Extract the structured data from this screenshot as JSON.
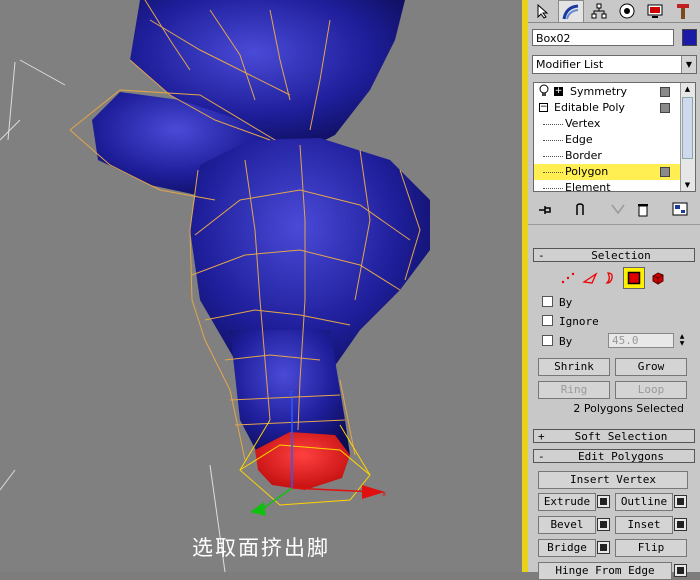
{
  "caption": "选取面挤出脚",
  "panel": {
    "tabs": [
      {
        "name": "create-tab",
        "icon": "pointer-icon"
      },
      {
        "name": "modify-tab",
        "icon": "curve-icon"
      },
      {
        "name": "hierarchy-tab",
        "icon": "hierarchy-icon"
      },
      {
        "name": "motion-tab",
        "icon": "motion-icon"
      },
      {
        "name": "display-tab",
        "icon": "monitor-icon"
      },
      {
        "name": "utilities-tab",
        "icon": "hammer-icon"
      }
    ],
    "object_name": "Box02",
    "object_color": "#1a1aa6",
    "modifier_list_label": "Modifier List",
    "stack": {
      "symmetry": "Symmetry",
      "editable_poly": "Editable Poly",
      "vertex": "Vertex",
      "edge": "Edge",
      "border": "Border",
      "polygon": "Polygon",
      "element": "Element"
    },
    "selection": {
      "title": "Selection",
      "by_vertex": "By",
      "ignore": "Ignore",
      "by_angle": "By",
      "angle_value": "45.0",
      "shrink": "Shrink",
      "grow": "Grow",
      "ring": "Ring",
      "loop": "Loop",
      "status": "2 Polygons Selected"
    },
    "soft_selection": {
      "title": "Soft Selection"
    },
    "edit_polygons": {
      "title": "Edit Polygons",
      "insert_vertex": "Insert Vertex",
      "extrude": "Extrude",
      "outline": "Outline",
      "bevel": "Bevel",
      "inset": "Inset",
      "bridge": "Bridge",
      "flip": "Flip",
      "hinge": "Hinge From Edge"
    },
    "rollout_minus": "-",
    "rollout_plus": "+"
  },
  "colors": {
    "mesh": "#1a1a8c",
    "selected_face": "#e00000",
    "wire": "#e3a54a",
    "highlight": "#ffef52"
  }
}
